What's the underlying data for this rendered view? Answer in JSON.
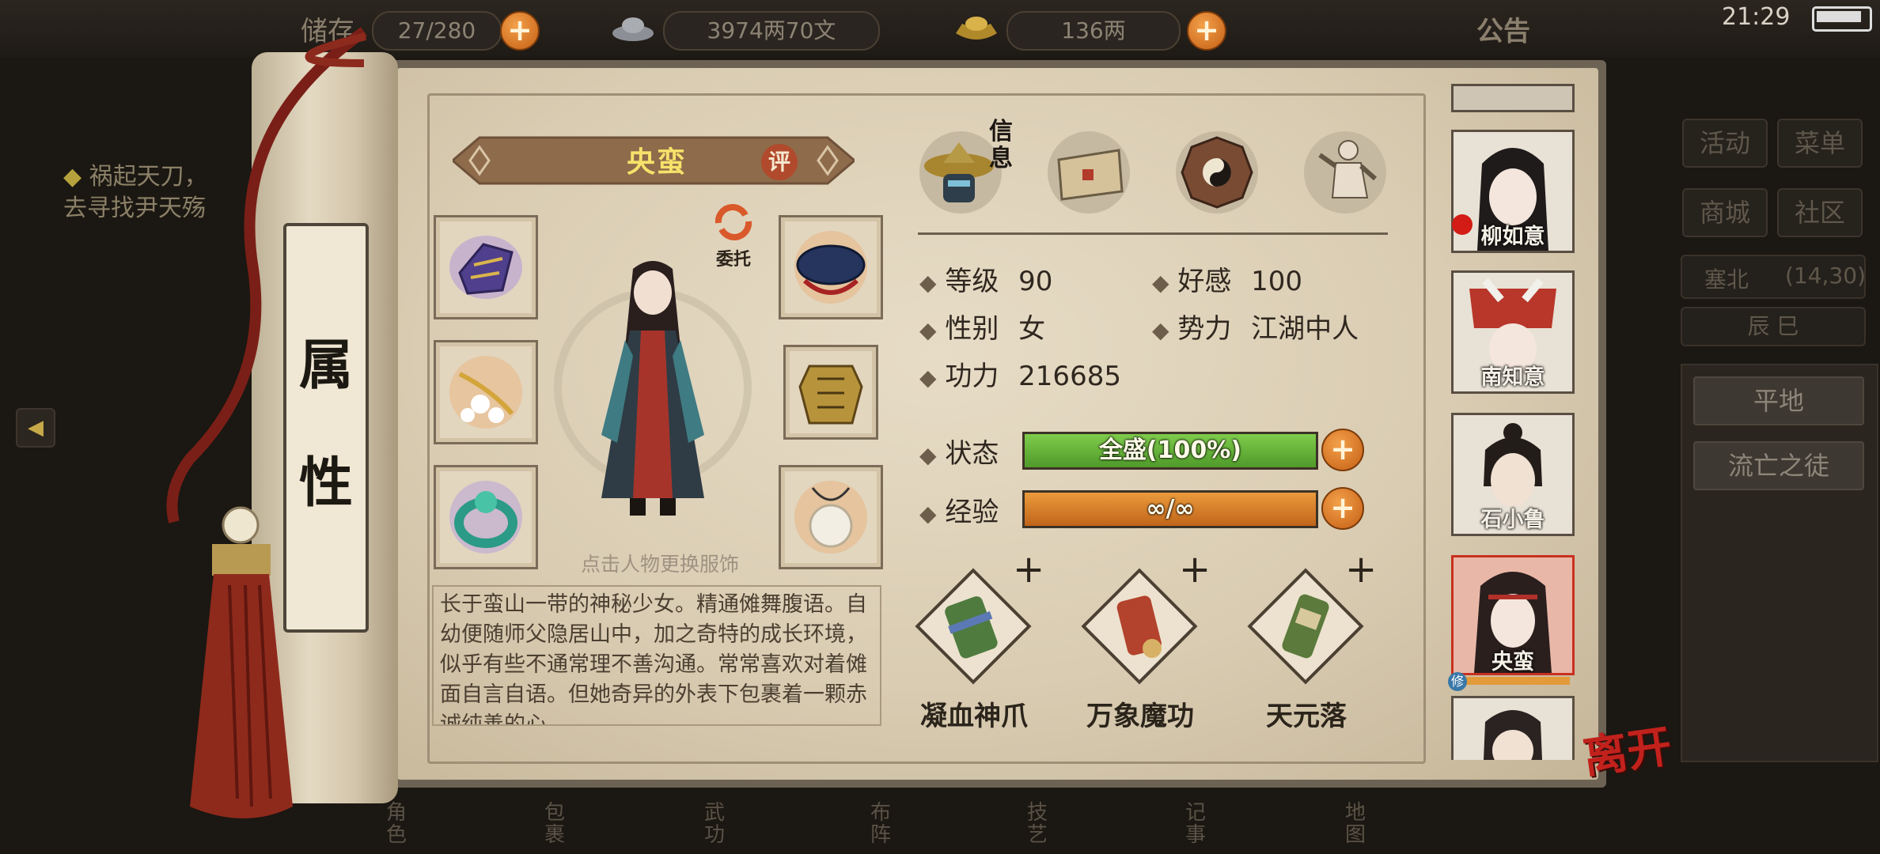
{
  "topbar": {
    "bag_label": "储存",
    "bag_count": "27/280",
    "money": "3974两70文",
    "gold": "136两",
    "notice": "公告",
    "time": "21:29"
  },
  "quest": {
    "line1": "祸起天刀，",
    "line2": "去寻找尹天殇"
  },
  "right_menu": {
    "activity": "活动",
    "menu": "菜单",
    "shop": "商城",
    "community": "社区",
    "location": "塞北",
    "coords": "(14,30)",
    "time_slot": "辰 巳",
    "terrain": "平地",
    "identity": "流亡之徒"
  },
  "bottom_nav": [
    "角色",
    "包裹",
    "武功",
    "布阵",
    "技艺",
    "记事",
    "地图"
  ],
  "scroll": {
    "tab_label_1": "属",
    "tab_label_2": "性"
  },
  "character": {
    "name": "央蛮",
    "rate_badge": "评",
    "delegate": "委托",
    "hint": "点击人物更换服饰",
    "bio": "长于蛮山一带的神秘少女。精通傩舞腹语。自幼便随师父隐居山中，加之奇特的成长环境，似乎有些不通常理不善沟通。常常喜欢对着傩面自言自语。但她奇异的外表下包裹着一颗赤诚纯善的心"
  },
  "tabs": {
    "info_label": "信息",
    "icons": [
      "info-hat-icon",
      "scroll-map-icon",
      "bagua-icon",
      "body-meridian-icon"
    ]
  },
  "stats": {
    "level_label": "等级",
    "level": "90",
    "favor_label": "好感",
    "favor": "100",
    "gender_label": "性别",
    "gender": "女",
    "faction_label": "势力",
    "faction": "江湖中人",
    "power_label": "功力",
    "power": "216685",
    "status_label": "状态",
    "status_value": "全盛(100%)",
    "status_fill": 1.0,
    "exp_label": "经验",
    "exp_value": "∞/∞",
    "exp_fill": 1.0
  },
  "skills": [
    {
      "name": "凝血神爪"
    },
    {
      "name": "万象魔功"
    },
    {
      "name": "天元落"
    }
  ],
  "companions": [
    {
      "name": "柳如意"
    },
    {
      "name": "南知意"
    },
    {
      "name": "石小鲁"
    },
    {
      "name": "央蛮"
    }
  ],
  "leave_label": "离开",
  "colors": {
    "status_bar": "#5da832",
    "exp_bar": "#d77d27",
    "accent_plus": "#e07f24",
    "leave_red": "#c2211c"
  }
}
